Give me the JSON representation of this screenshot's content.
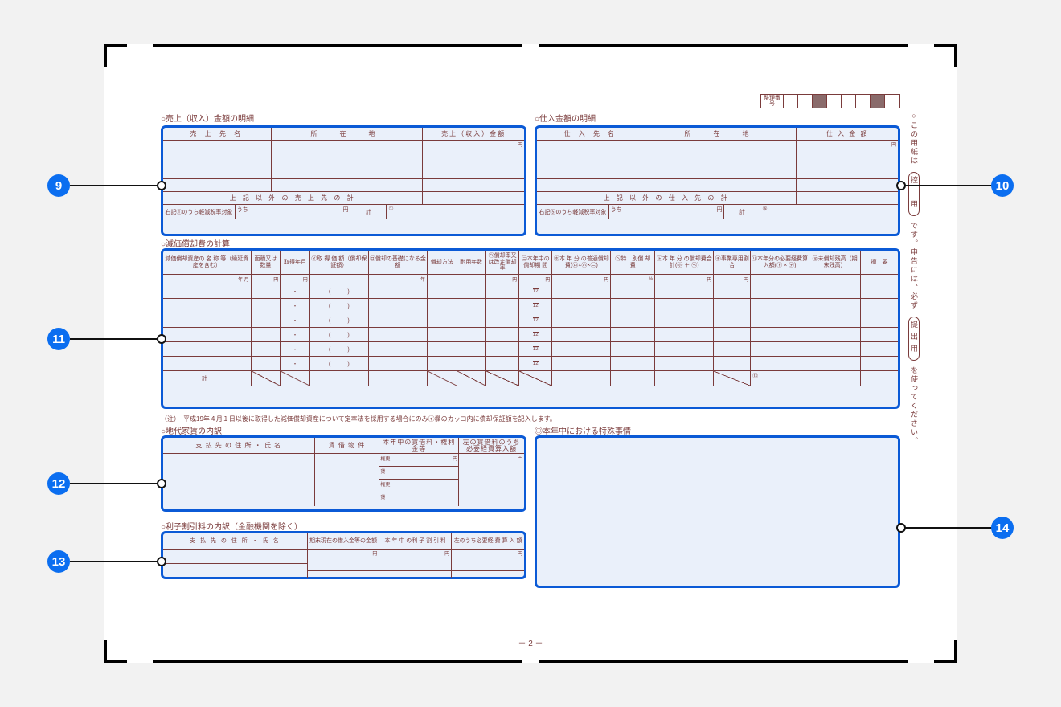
{
  "seiri_label": "整理番号",
  "sections": {
    "sales": {
      "title": "○売上（収入）金額の明細",
      "columns": [
        "売 上 先 名",
        "所　在　地",
        "売上（収入）金額"
      ],
      "yen": "円",
      "subtotal_label": "上 記 以 外 の 売 上 先 の 計",
      "footer_left": "右記①のうち軽減税率対象",
      "uchi": "うち",
      "kei": "計",
      "mark": "①"
    },
    "purchases": {
      "title": "○仕入金額の明細",
      "columns": [
        "仕 入 先 名",
        "所　在　地",
        "仕 入 金 額"
      ],
      "yen": "円",
      "subtotal_label": "上 記 以 外 の 仕 入 先 の 計",
      "footer_left": "右記⑤のうち軽減税率対象",
      "uchi": "うち",
      "kei": "計",
      "mark": "⑤"
    },
    "depreciation": {
      "title": "○減価償却費の計算",
      "headers": [
        "減価償却資産の 名 称 等（繰延資産を含む）",
        "面積又は数量",
        "取得年月",
        "㋑取 得 価 額（償却保証額）",
        "㋺償却の基礎になる金額",
        "償却方法",
        "耐用年数",
        "㋩償却率又は改定償却率",
        "㋥本年中の償却期 間",
        "㋭本 年 分 の普通償却費(㋺×㋩×㋥)",
        "㋬特　別償 却 費",
        "㋣本 年 分 の償却費合計(㋭ ＋ ㋬)",
        "㋠事業専用割合",
        "㋷本年分の必要経費算入額(㋣ × ㋠)",
        "㋦未償却残高（期末残高）",
        "摘　要"
      ],
      "subheader": [
        "年 月",
        "円",
        "円",
        "",
        "年",
        "",
        "",
        "円",
        "円",
        "円",
        "%",
        "円",
        "円",
        ""
      ],
      "row_month": "12",
      "total_label": "計",
      "total_mark": "⑬",
      "footnote": "（注）　平成19年４月１日以後に取得した減価償却資産について定率法を採用する場合にのみ㋑欄のカッコ内に償却保証額を記入します。"
    },
    "rent": {
      "title": "○地代家賃の内訳",
      "headers": [
        "支 払 先 の 住 所 ・ 氏 名",
        "賃 借 物 件",
        "本年中の賃借料・権利金等",
        "左の賃借料のうち必要経費算入額"
      ],
      "sub_labels": [
        "権更",
        "貸",
        "権更",
        "貸"
      ],
      "yen": "円"
    },
    "interest": {
      "title": "○利子割引料の内訳（金融機関を除く）",
      "headers": [
        "支 払 先 の 住 所 ・ 氏 名",
        "期末現在の借入金等の金額",
        "本 年 中 の利 子 割 引 料",
        "左のうち必要経 費 算 入 額"
      ],
      "yen": "円"
    },
    "special": {
      "title": "◎本年中における特殊事情"
    }
  },
  "side_note": {
    "prefix": "○この用紙は",
    "rounded1": "控　用",
    "middle": "です。申告には、必ず",
    "rounded2": "提出用",
    "suffix": "を使ってください。"
  },
  "page_number": "－ 2 －",
  "callouts": {
    "c9": "9",
    "c10": "10",
    "c11": "11",
    "c12": "12",
    "c13": "13",
    "c14": "14"
  }
}
